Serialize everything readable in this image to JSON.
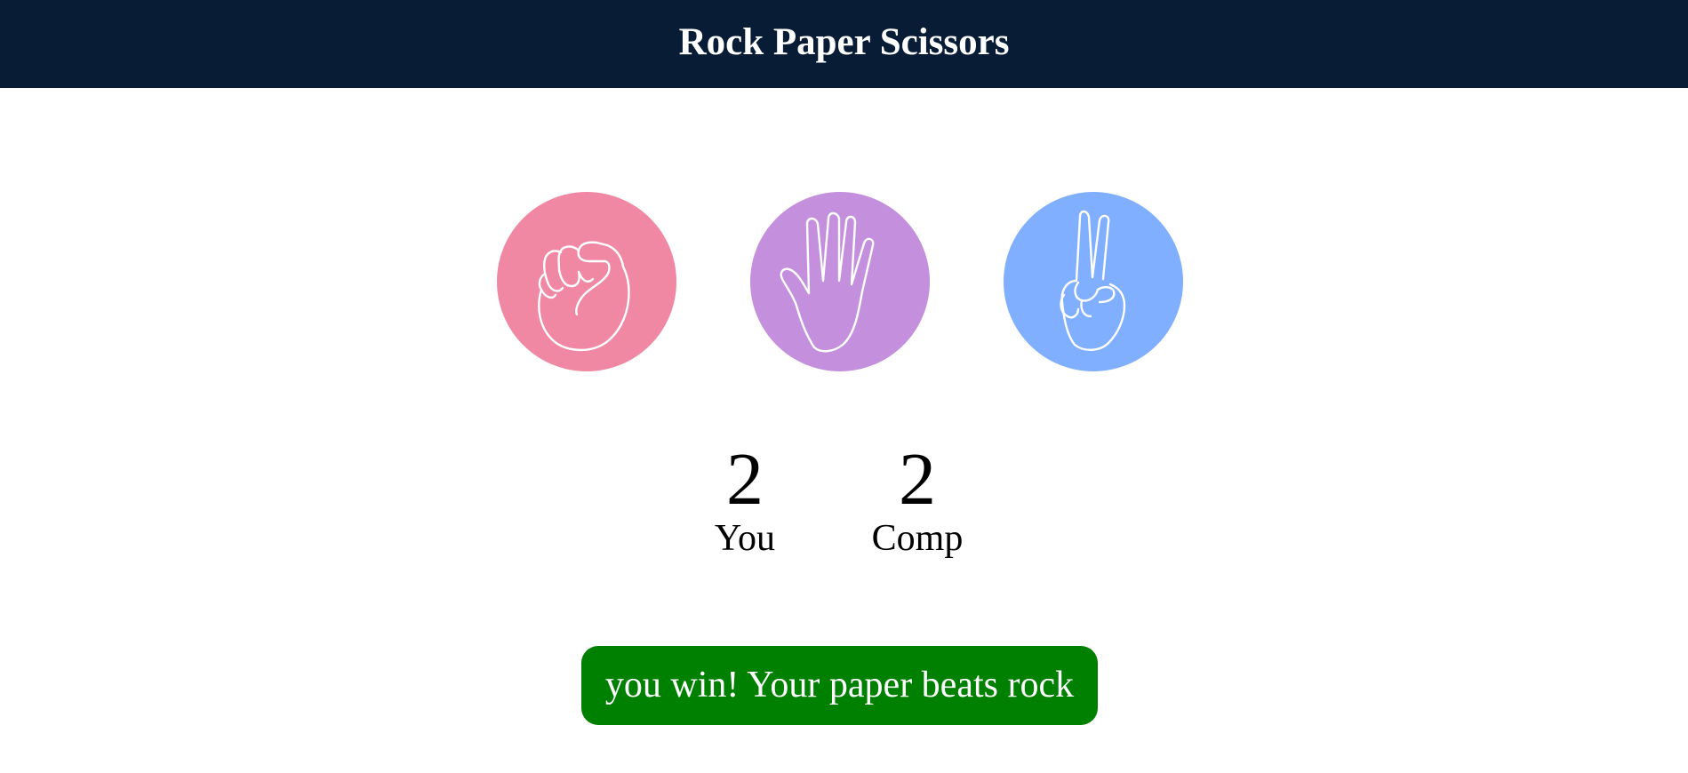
{
  "header": {
    "title": "Rock Paper Scissors"
  },
  "choices": [
    {
      "name": "rock",
      "icon": "rock-fist-icon",
      "color": "#f088a3"
    },
    {
      "name": "paper",
      "icon": "paper-hand-icon",
      "color": "#c490de"
    },
    {
      "name": "scissors",
      "icon": "scissors-peace-icon",
      "color": "#80afff"
    }
  ],
  "scores": {
    "user": {
      "value": "2",
      "label": "You"
    },
    "comp": {
      "value": "2",
      "label": "Comp"
    }
  },
  "result": {
    "message": "you win! Your paper beats rock",
    "color": "#008000"
  },
  "colors": {
    "header_bg": "#081c36",
    "header_text": "#ffffff"
  }
}
